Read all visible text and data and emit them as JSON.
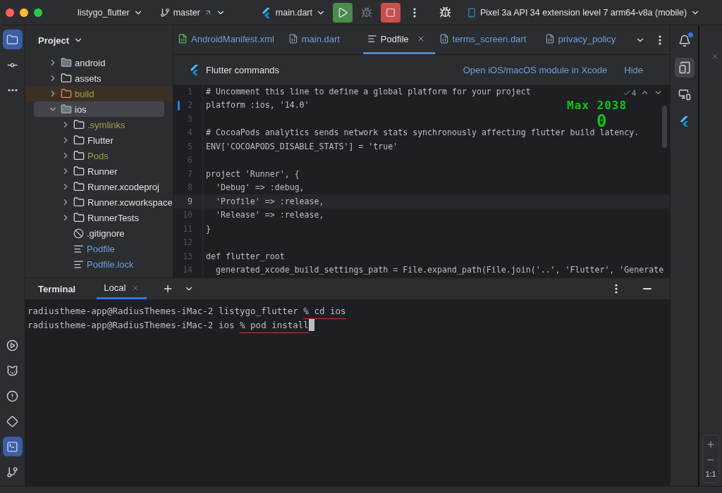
{
  "title_bar": {
    "project": "listygo_flutter",
    "branch": "master",
    "run_config": "main.dart",
    "device": "Pixel 3a API 34 extension level 7 arm64-v8a (mobile)"
  },
  "left_toolbar": {
    "top": [
      {
        "kind": "folder",
        "selected": true
      },
      {
        "kind": "commit",
        "selected": false
      },
      {
        "kind": "more",
        "selected": false
      }
    ],
    "bottom": [
      {
        "kind": "run",
        "selected": false
      },
      {
        "kind": "cat",
        "selected": false
      },
      {
        "kind": "problems",
        "selected": false
      },
      {
        "kind": "diamond",
        "selected": false
      },
      {
        "kind": "terminal",
        "selected": true
      },
      {
        "kind": "git",
        "selected": false
      }
    ]
  },
  "project_panel": {
    "title": "Project",
    "tree": [
      {
        "name": "android",
        "kind": "android",
        "ignored": false,
        "modified": false,
        "selected": false,
        "expanded": false
      },
      {
        "name": "assets",
        "kind": "folder",
        "ignored": false,
        "modified": false,
        "selected": false,
        "expanded": false
      },
      {
        "name": "build",
        "kind": "excluded",
        "ignored": true,
        "modified": false,
        "selected": false,
        "expanded": false
      },
      {
        "name": "ios",
        "kind": "ios",
        "ignored": false,
        "modified": false,
        "selected": true,
        "expanded": true,
        "children": [
          {
            "name": ".symlinks",
            "kind": "folder",
            "ignored": true,
            "modified": false,
            "selected": false,
            "expanded": false
          },
          {
            "name": "Flutter",
            "kind": "folder",
            "ignored": false,
            "modified": false,
            "selected": false,
            "expanded": false
          },
          {
            "name": "Pods",
            "kind": "folder",
            "ignored": true,
            "modified": false,
            "selected": false,
            "expanded": false
          },
          {
            "name": "Runner",
            "kind": "folder",
            "ignored": false,
            "modified": false,
            "selected": false,
            "expanded": false
          },
          {
            "name": "Runner.xcodeproj",
            "kind": "folder",
            "ignored": false,
            "modified": false,
            "selected": false,
            "expanded": false
          },
          {
            "name": "Runner.xcworkspace",
            "kind": "folder",
            "ignored": false,
            "modified": false,
            "selected": false,
            "expanded": false
          },
          {
            "name": "RunnerTests",
            "kind": "folder",
            "ignored": false,
            "modified": false,
            "selected": false,
            "expanded": false
          },
          {
            "name": ".gitignore",
            "kind": "ignore",
            "ignored": false,
            "modified": false,
            "selected": false
          },
          {
            "name": "Podfile",
            "kind": "text",
            "ignored": false,
            "modified": true,
            "selected": false
          },
          {
            "name": "Podfile.lock",
            "kind": "text",
            "ignored": false,
            "modified": true,
            "selected": false
          }
        ]
      }
    ]
  },
  "editor_tabs": [
    {
      "label": "AndroidManifest.xml",
      "kind": "xml",
      "selected": false
    },
    {
      "label": "main.dart",
      "kind": "dart",
      "selected": false
    },
    {
      "label": "Podfile",
      "kind": "text",
      "selected": true
    },
    {
      "label": "terms_screen.dart",
      "kind": "dart",
      "selected": false
    },
    {
      "label": "privacy_policy",
      "kind": "dart",
      "selected": false
    }
  ],
  "banner": {
    "title": "Flutter commands",
    "link": "Open iOS/macOS module in Xcode",
    "hide": "Hide"
  },
  "inspections": {
    "count": "4"
  },
  "overlay": {
    "caption": "Max 2038",
    "value": "0"
  },
  "code_lines": [
    {
      "number": "1",
      "text": "# Uncomment this line to define a global platform for your project",
      "current": false,
      "changed": false
    },
    {
      "number": "2",
      "text": "platform :ios, '14.0'",
      "current": false,
      "changed": true
    },
    {
      "number": "3",
      "current": false,
      "changed": false
    },
    {
      "number": "4",
      "text": "# CocoaPods analytics sends network stats synchronously affecting flutter build latency.",
      "current": false,
      "changed": false
    },
    {
      "number": "5",
      "text": "ENV['COCOAPODS_DISABLE_STATS'] = 'true'",
      "current": false,
      "changed": false
    },
    {
      "number": "6",
      "current": false,
      "changed": false
    },
    {
      "number": "7",
      "text": "project 'Runner', {",
      "current": false,
      "changed": false
    },
    {
      "number": "8",
      "text": "  'Debug' => :debug,",
      "current": false,
      "changed": false
    },
    {
      "number": "9",
      "text": "  'Profile' => :release,",
      "current": true,
      "changed": false
    },
    {
      "number": "10",
      "text": "  'Release' => :release,",
      "current": false,
      "changed": false
    },
    {
      "number": "11",
      "text": "}",
      "current": false,
      "changed": false
    },
    {
      "number": "12",
      "current": false,
      "changed": false
    },
    {
      "number": "13",
      "text": "def flutter_root",
      "current": false,
      "changed": false
    },
    {
      "number": "14",
      "text": "  generated_xcode_build_settings_path = File.expand_path(File.join('..', 'Flutter', 'Generate",
      "current": false,
      "changed": false
    }
  ],
  "terminal": {
    "title": "Terminal",
    "tabs": [
      {
        "label": "Local",
        "selected": true
      }
    ],
    "lines": [
      {
        "prompt": "radiustheme-app@RadiusThemes-iMac-2 listygo_flutter",
        "command": "% cd ios",
        "cursor": false
      },
      {
        "prompt": "radiustheme-app@RadiusThemes-iMac-2 ios",
        "command": "% pod install",
        "cursor": true
      }
    ]
  },
  "right_toolbar": [
    {
      "kind": "bell",
      "selected": false,
      "badge": true
    },
    {
      "kind": "device",
      "selected": true,
      "badge": false
    },
    {
      "kind": "running",
      "selected": false,
      "badge": false
    },
    {
      "kind": "flutter",
      "selected": false,
      "badge": false
    }
  ],
  "emulator_controls": {
    "zoom_reset": "1:1"
  }
}
